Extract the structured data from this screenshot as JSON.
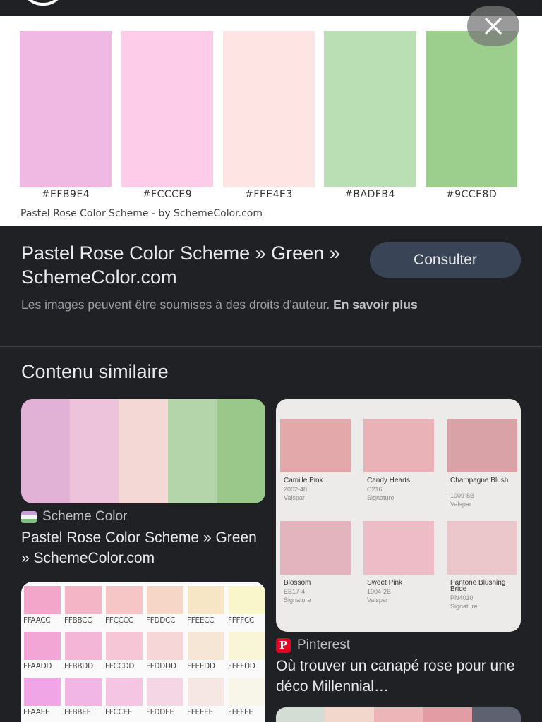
{
  "preview": {
    "swatches": [
      {
        "hex": "#EFB9E4",
        "label": "#EFB9E4"
      },
      {
        "hex": "#FCCCE9",
        "label": "#FCCCE9"
      },
      {
        "hex": "#FEE4E3",
        "label": "#FEE4E3"
      },
      {
        "hex": "#BADFB4",
        "label": "#BADFB4"
      },
      {
        "hex": "#9CCE8D",
        "label": "#9CCE8D"
      }
    ],
    "credit": "Pastel Rose  Color Scheme - by SchemeColor.com"
  },
  "result": {
    "title": "Pastel Rose Color Scheme » Green » SchemeColor.com",
    "visit_label": "Consulter",
    "rights_text": "Les images peuvent être soumises à des droits d'auteur.",
    "rights_link": "En savoir plus"
  },
  "similar": {
    "heading": "Contenu similaire",
    "items": [
      {
        "source": "Scheme Color",
        "caption": "Pastel Rose Color Scheme » Green » SchemeColor.com",
        "colors": [
          "#E2B1D6",
          "#EDC3DC",
          "#F3D8D6",
          "#B4D4AA",
          "#9AC78A"
        ]
      },
      {
        "source": "Pinterest",
        "caption": "Où trouver un canapé rose pour une déco Millennial…",
        "paints": [
          {
            "name": "Camille Pink",
            "code": "2002-48",
            "brand": "Valspar",
            "color": "#E2A8AA"
          },
          {
            "name": "Candy Hearts",
            "code": "C216",
            "brand": "Signature",
            "color": "#E8B2B6"
          },
          {
            "name": "Champagne Blush",
            "code": "1009-8B",
            "brand": "Valspar",
            "color": "#D8A2A6"
          },
          {
            "name": "Blossom",
            "code": "EB17-4",
            "brand": "Signature",
            "color": "#E3B4BE"
          },
          {
            "name": "Sweet Pink",
            "code": "1004-2B",
            "brand": "Valspar",
            "color": "#EDBCC6"
          },
          {
            "name": "Pantone Blushing Bride",
            "code": "PN4010",
            "brand": "Signature",
            "color": "#EBC6CA"
          }
        ]
      },
      {
        "grid": [
          [
            {
              "c": "#F4A6CA",
              "l": "FFAACC"
            },
            {
              "c": "#F4B6C6",
              "l": "FFBBCC"
            },
            {
              "c": "#F6C6C6",
              "l": "FFCCCC"
            },
            {
              "c": "#F6D6C6",
              "l": "FFDDCC"
            },
            {
              "c": "#F6E6C6",
              "l": "FFEECC"
            },
            {
              "c": "#F8F6CA",
              "l": "FFFFCC"
            }
          ],
          [
            {
              "c": "#F2A6D6",
              "l": "FFAADD"
            },
            {
              "c": "#F4B6D6",
              "l": "FFBBDD"
            },
            {
              "c": "#F6C6D6",
              "l": "FFCCDD"
            },
            {
              "c": "#F6D6D6",
              "l": "FFDDDD"
            },
            {
              "c": "#F6E6D6",
              "l": "FFEEDD"
            },
            {
              "c": "#F8F6D6",
              "l": "FFFFDD"
            }
          ],
          [
            {
              "c": "#F0A6E6",
              "l": "FFAAEE"
            },
            {
              "c": "#F2B6E4",
              "l": "FFBBEE"
            },
            {
              "c": "#F4C6E4",
              "l": "FFCCEE"
            },
            {
              "c": "#F4D6E4",
              "l": "FFDDEE"
            },
            {
              "c": "#F6E6E4",
              "l": "FFEEEE"
            },
            {
              "c": "#F8F6E8",
              "l": "FFFFEE"
            }
          ]
        ]
      },
      {
        "colors": [
          "#D3DDD4",
          "#F1D7CC",
          "#EDB5B8",
          "#E29CA4",
          "#5E6170"
        ]
      }
    ]
  }
}
